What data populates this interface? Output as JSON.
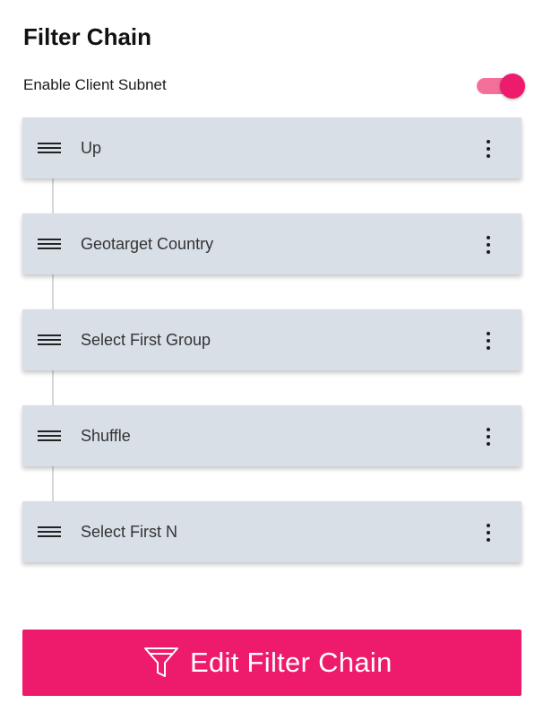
{
  "header": {
    "title": "Filter Chain"
  },
  "client_subnet": {
    "label": "Enable Client Subnet",
    "enabled": true
  },
  "filters": [
    {
      "label": "Up"
    },
    {
      "label": "Geotarget Country"
    },
    {
      "label": "Select First Group"
    },
    {
      "label": "Shuffle"
    },
    {
      "label": "Select First N"
    }
  ],
  "icons": {
    "drag": "drag-handle-icon",
    "menu": "more-vertical-icon",
    "edit": "funnel-icon"
  },
  "colors": {
    "accent": "#ee1a6c",
    "toggle_track": "#f4709b",
    "card_background": "#d9dfe7",
    "connector": "#d3d8df"
  },
  "actions": {
    "edit_label": "Edit Filter Chain"
  }
}
